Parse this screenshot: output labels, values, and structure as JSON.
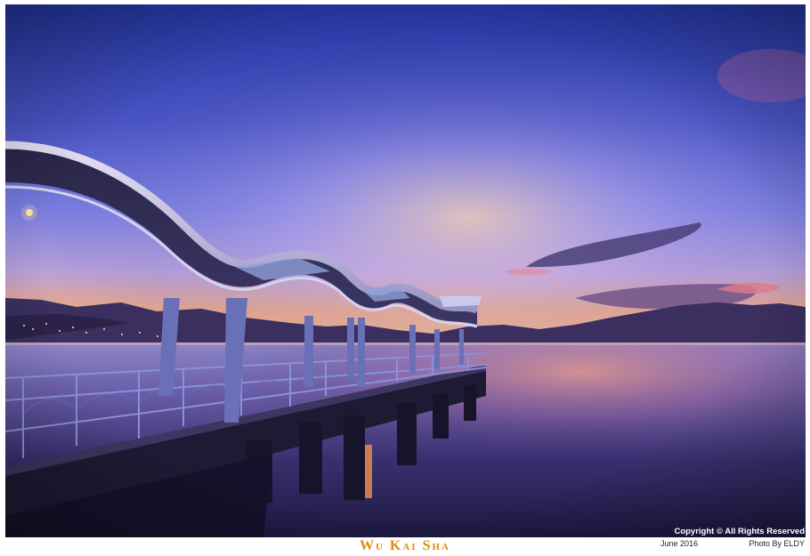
{
  "photo": {
    "subject": "",
    "colors": {
      "sky_top": "#2a3fa0",
      "sky_mid": "#6f76d8",
      "horizon_glow": "#f2a27a",
      "pink_cloud": "#e06f9a",
      "water_dark": "#241f4a",
      "water_reflection": "#c98a9c",
      "pier_dark": "#1c1a30",
      "roof_light": "#d9d6ee",
      "railing": "#7f86d8"
    }
  },
  "copyright": "Copyright © All Rights Reserved",
  "credit": {
    "date": "June 2016",
    "author": "Photo By ELDY"
  },
  "caption": {
    "title": "Wu Kai Sha",
    "color": "#e08a10"
  }
}
